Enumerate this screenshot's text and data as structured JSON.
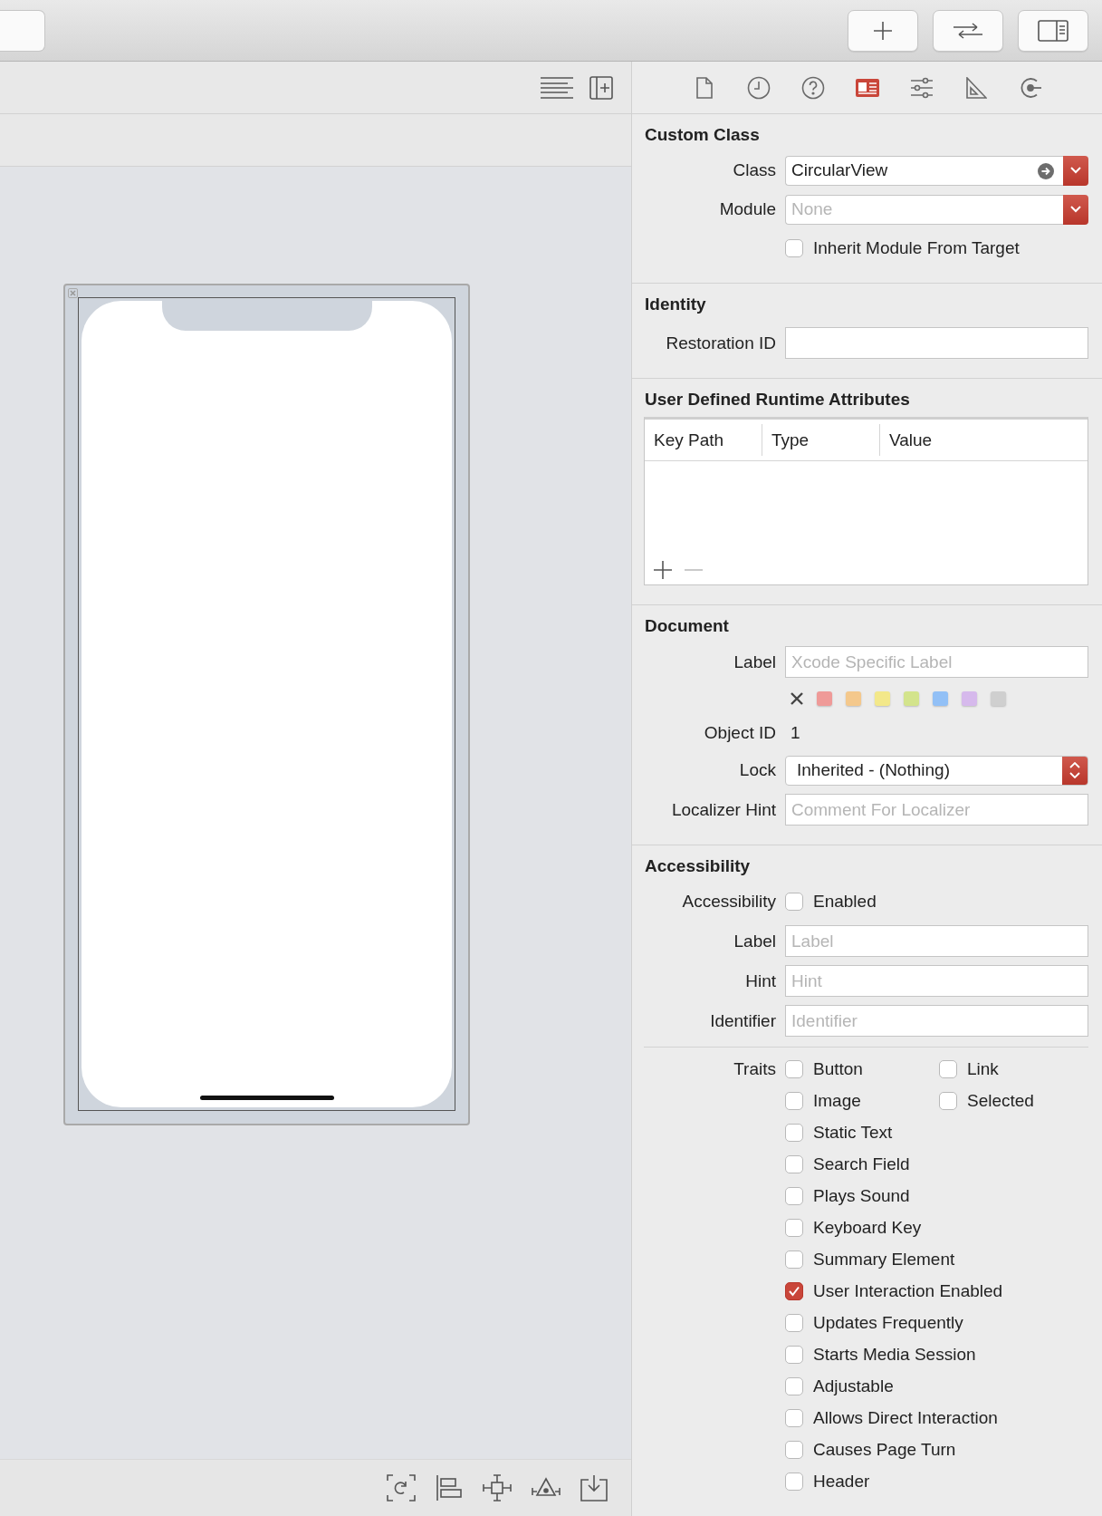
{
  "inspector_tabs": [
    {
      "kind": "file",
      "selected": false
    },
    {
      "kind": "history",
      "selected": false
    },
    {
      "kind": "help",
      "selected": false
    },
    {
      "kind": "identity",
      "selected": true
    },
    {
      "kind": "attributes",
      "selected": false
    },
    {
      "kind": "size",
      "selected": false
    },
    {
      "kind": "connections",
      "selected": false
    }
  ],
  "custom_class": {
    "title": "Custom Class",
    "class_label": "Class",
    "class_value": "CircularView",
    "module_label": "Module",
    "module_placeholder": "None",
    "inherit": {
      "label": "Inherit Module From Target",
      "checked": false
    }
  },
  "identity": {
    "title": "Identity",
    "restoration_label": "Restoration ID"
  },
  "runtime_attributes": {
    "title": "User Defined Runtime Attributes",
    "columns": [
      "Key Path",
      "Type",
      "Value"
    ],
    "remove_disabled": true
  },
  "document": {
    "title": "Document",
    "label_label": "Label",
    "label_placeholder": "Xcode Specific Label",
    "colors": [
      {
        "color": "#ef9a98"
      },
      {
        "color": "#f4c88c"
      },
      {
        "color": "#f3e88a"
      },
      {
        "color": "#d3e48c"
      },
      {
        "color": "#92c0f6"
      },
      {
        "color": "#d6b9ec"
      },
      {
        "color": "#cfcfcf"
      }
    ],
    "object_id_label": "Object ID",
    "object_id": "1",
    "lock_label": "Lock",
    "lock_value": "Inherited - (Nothing)",
    "hint_label": "Localizer Hint",
    "hint_placeholder": "Comment For Localizer"
  },
  "accessibility": {
    "title": "Accessibility",
    "enabled_label": "Accessibility",
    "enabled": {
      "label": "Enabled",
      "checked": false
    },
    "label_label": "Label",
    "label_placeholder": "Label",
    "hint_label": "Hint",
    "hint_placeholder": "Hint",
    "identifier_label": "Identifier",
    "identifier_placeholder": "Identifier",
    "traits_label": "Traits",
    "traits": [
      [
        {
          "label": "Button",
          "checked": false
        },
        {
          "label": "Link",
          "checked": false
        }
      ],
      [
        {
          "label": "Image",
          "checked": false
        },
        {
          "label": "Selected",
          "checked": false
        }
      ],
      [
        {
          "label": "Static Text",
          "checked": false
        }
      ],
      [
        {
          "label": "Search Field",
          "checked": false
        }
      ],
      [
        {
          "label": "Plays Sound",
          "checked": false
        }
      ],
      [
        {
          "label": "Keyboard Key",
          "checked": false
        }
      ],
      [
        {
          "label": "Summary Element",
          "checked": false
        }
      ],
      [
        {
          "label": "User Interaction Enabled",
          "checked": true
        }
      ],
      [
        {
          "label": "Updates Frequently",
          "checked": false
        }
      ],
      [
        {
          "label": "Starts Media Session",
          "checked": false
        }
      ],
      [
        {
          "label": "Adjustable",
          "checked": false
        }
      ],
      [
        {
          "label": "Allows Direct Interaction",
          "checked": false
        }
      ],
      [
        {
          "label": "Causes Page Turn",
          "checked": false
        }
      ],
      [
        {
          "label": "Header",
          "checked": false
        }
      ]
    ]
  }
}
